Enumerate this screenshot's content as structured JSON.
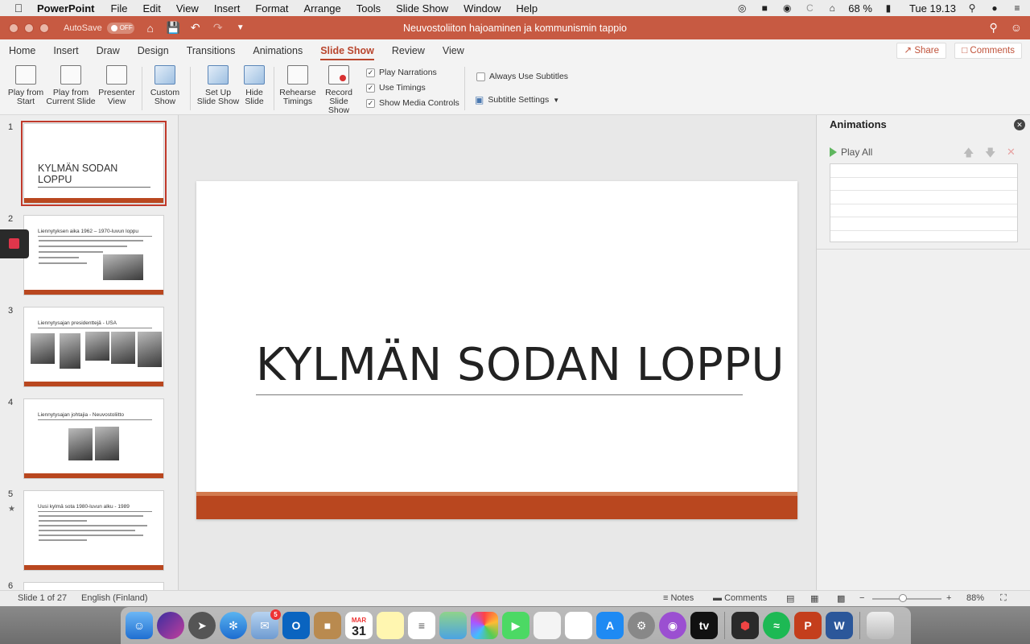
{
  "menubar": {
    "app": "PowerPoint",
    "menus": [
      "File",
      "Edit",
      "View",
      "Insert",
      "Format",
      "Arrange",
      "Tools",
      "Slide Show",
      "Window",
      "Help"
    ],
    "battery": "68 %",
    "clock": "Tue 19.13"
  },
  "window": {
    "autosave_label": "AutoSave",
    "autosave_state": "OFF",
    "doc_title": "Neuvostoliiton hajoaminen ja kommunismin tappio"
  },
  "ribbon": {
    "tabs": [
      "Home",
      "Insert",
      "Draw",
      "Design",
      "Transitions",
      "Animations",
      "Slide Show",
      "Review",
      "View"
    ],
    "active_tab": "Slide Show",
    "share": "Share",
    "comments": "Comments",
    "tools": {
      "play_from_start": [
        "Play from",
        "Start"
      ],
      "play_from_current": [
        "Play from",
        "Current Slide"
      ],
      "presenter_view": [
        "Presenter",
        "View"
      ],
      "custom_show": [
        "Custom",
        "Show"
      ],
      "set_up": [
        "Set Up",
        "Slide Show"
      ],
      "hide_slide": [
        "Hide",
        "Slide"
      ],
      "rehearse": [
        "Rehearse",
        "Timings"
      ],
      "record": [
        "Record",
        "Slide Show"
      ]
    },
    "checks": {
      "play_narrations": "Play Narrations",
      "use_timings": "Use Timings",
      "show_media_controls": "Show Media Controls",
      "always_use_subtitles": "Always Use Subtitles",
      "subtitle_settings": "Subtitle Settings"
    }
  },
  "thumbnails": [
    {
      "num": "1",
      "title": "KYLMÄN SODAN LOPPU"
    },
    {
      "num": "2",
      "title": "Liennytyksen aika 1962 – 1970-luvun loppu"
    },
    {
      "num": "3",
      "title": "Liennytysajan presidenttejä - USA"
    },
    {
      "num": "4",
      "title": "Liennytysajan johtajia - Neuvostoliitto"
    },
    {
      "num": "5",
      "title": "Uusi kylmä sota 1980-luvun alku - 1989"
    },
    {
      "num": "6",
      "title": ""
    }
  ],
  "slide": {
    "title": "KYLMÄN SODAN LOPPU"
  },
  "animations": {
    "title": "Animations",
    "play_all": "Play All"
  },
  "status": {
    "slide_of": "Slide 1 of 27",
    "language": "English (Finland)",
    "notes": "Notes",
    "comments": "Comments",
    "zoom": "88%"
  },
  "dock": {
    "calendar_month": "MAR",
    "calendar_day": "31",
    "mail_badge": "5"
  },
  "colors": {
    "accent": "#c75a42",
    "slide_bar": "#b9471f"
  }
}
